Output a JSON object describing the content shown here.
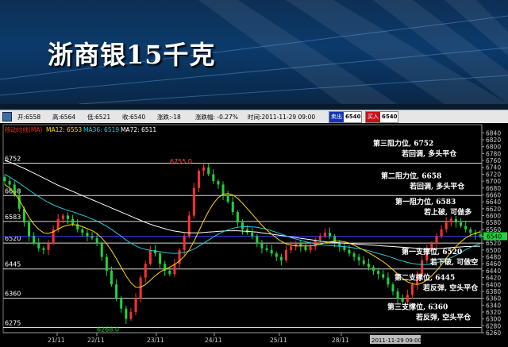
{
  "banner": {
    "title": "浙商银15千克"
  },
  "toolbar": {
    "open": "开:6558",
    "high": "高:6564",
    "low": "低:6521",
    "close": "收:6540",
    "change": "涨跌:-18",
    "change_pct": "涨跌幅: -0.27%",
    "time": "时间:2011-11-29 09:00",
    "sell_label": "卖出",
    "sell_value": "6540",
    "buy_label": "买入",
    "buy_value": "6540"
  },
  "indicator": {
    "name": "移动均线(MA)",
    "ma12": "MA12: 6553",
    "ma36": "MA36: 6519",
    "ma72": "MA72: 6511",
    "colors": {
      "ma12": "#ffd800",
      "ma36": "#29c8d8",
      "ma72": "#ffffff"
    }
  },
  "chart_data": {
    "type": "line",
    "price_range": [
      6260,
      6850
    ],
    "y_ticks": [
      "6840",
      "6820",
      "6800",
      "6780",
      "6760",
      "6740",
      "6720",
      "6700",
      "6680",
      "6660",
      "6640",
      "6620",
      "6600",
      "6580",
      "6560",
      "6540",
      "6520",
      "6500",
      "6480",
      "6460",
      "6440",
      "6420",
      "6400",
      "6380",
      "6360",
      "6340",
      "6320",
      "6300",
      "6280",
      "6260"
    ],
    "x_labels": [
      "21/11",
      "22/11",
      "23/11",
      "24/11",
      "25/11",
      "28/11"
    ],
    "x_cursor_label": "2011-11-29 09:00",
    "current_price": "6540",
    "markers": [
      {
        "label": "6755.0",
        "value": 6755
      },
      {
        "label": "6268.0",
        "value": 6268
      }
    ],
    "levels": [
      {
        "value": 6752,
        "label": "6752",
        "title": "第三阻力位, 6752",
        "advice": "若回调, 多头平仓"
      },
      {
        "value": 6658,
        "label": "6658",
        "title": "第二阻力位, 6658",
        "advice": "若回调, 多头平仓"
      },
      {
        "value": 6583,
        "label": "6583",
        "title": "第一阻力位, 6583",
        "advice": "若上破, 可做多"
      },
      {
        "value": 6520,
        "label": "6520",
        "title": "第一支撑位, 6520",
        "advice": "若下破, 可做空"
      },
      {
        "value": 6445,
        "label": "6445",
        "title": "第二支撑位, 6445",
        "advice": "若反弹, 空头平仓"
      },
      {
        "value": 6360,
        "label": "6360",
        "title": "第三支撑位, 6360",
        "advice": "若反弹, 空头平仓"
      },
      {
        "value": 6275,
        "label": "6275"
      }
    ],
    "closes": [
      6700,
      6690,
      6660,
      6620,
      6580,
      6540,
      6520,
      6505,
      6500,
      6520,
      6560,
      6590,
      6600,
      6590,
      6575,
      6560,
      6550,
      6540,
      6535,
      6520,
      6480,
      6440,
      6400,
      6360,
      6330,
      6300,
      6320,
      6360,
      6420,
      6460,
      6500,
      6490,
      6460,
      6440,
      6430,
      6460,
      6500,
      6540,
      6600,
      6680,
      6730,
      6740,
      6720,
      6700,
      6690,
      6660,
      6640,
      6610,
      6580,
      6560,
      6550,
      6540,
      6520,
      6505,
      6500,
      6490,
      6480,
      6470,
      6500,
      6510,
      6520,
      6510,
      6500,
      6510,
      6530,
      6540,
      6550,
      6540,
      6520,
      6510,
      6500,
      6490,
      6480,
      6470,
      6460,
      6450,
      6440,
      6430,
      6420,
      6400,
      6380,
      6360,
      6350,
      6370,
      6400,
      6430,
      6470,
      6500,
      6520,
      6540,
      6560,
      6580,
      6590,
      6580,
      6570,
      6560,
      6550,
      6545,
      6540
    ],
    "ma12": [
      6690,
      6680,
      6665,
      6645,
      6620,
      6595,
      6575,
      6560,
      6550,
      6548,
      6553,
      6560,
      6568,
      6572,
      6574,
      6572,
      6568,
      6562,
      6556,
      6548,
      6535,
      6518,
      6498,
      6475,
      6450,
      6425,
      6405,
      6392,
      6392,
      6400,
      6412,
      6425,
      6436,
      6444,
      6450,
      6458,
      6468,
      6482,
      6500,
      6525,
      6555,
      6585,
      6612,
      6635,
      6652,
      6662,
      6664,
      6660,
      6650,
      6636,
      6620,
      6604,
      6588,
      6572,
      6558,
      6546,
      6535,
      6525,
      6518,
      6514,
      6512,
      6512,
      6512,
      6512,
      6514,
      6517,
      6521,
      6524,
      6526,
      6526,
      6524,
      6520,
      6514,
      6507,
      6500,
      6492,
      6484,
      6475,
      6466,
      6455,
      6443,
      6430,
      6418,
      6408,
      6402,
      6400,
      6404,
      6413,
      6425,
      6440,
      6457,
      6476,
      6494,
      6510,
      6524,
      6535,
      6543,
      6549,
      6553
    ],
    "ma36": [
      6720,
      6712,
      6703,
      6694,
      6684,
      6674,
      6664,
      6655,
      6646,
      6638,
      6631,
      6625,
      6620,
      6615,
      6611,
      6606,
      6601,
      6596,
      6590,
      6584,
      6577,
      6569,
      6560,
      6550,
      6540,
      6529,
      6520,
      6512,
      6506,
      6502,
      6499,
      6497,
      6495,
      6493,
      6491,
      6490,
      6491,
      6493,
      6497,
      6503,
      6511,
      6520,
      6529,
      6538,
      6546,
      6553,
      6559,
      6563,
      6566,
      6568,
      6568,
      6567,
      6566,
      6563,
      6560,
      6556,
      6551,
      6546,
      6541,
      6536,
      6532,
      6528,
      6524,
      6521,
      6518,
      6516,
      6514,
      6513,
      6512,
      6511,
      6510,
      6508,
      6506,
      6504,
      6501,
      6498,
      6494,
      6490,
      6486,
      6482,
      6477,
      6472,
      6468,
      6464,
      6461,
      6459,
      6458,
      6458,
      6460,
      6463,
      6467,
      6472,
      6478,
      6485,
      6493,
      6501,
      6508,
      6514,
      6519
    ],
    "ma72": [
      6760,
      6755,
      6749,
      6743,
      6737,
      6730,
      6723,
      6716,
      6709,
      6702,
      6695,
      6688,
      6682,
      6676,
      6670,
      6664,
      6658,
      6652,
      6646,
      6640,
      6634,
      6628,
      6622,
      6616,
      6610,
      6604,
      6598,
      6592,
      6586,
      6580,
      6575,
      6570,
      6566,
      6562,
      6558,
      6555,
      6553,
      6551,
      6550,
      6550,
      6550,
      6551,
      6552,
      6553,
      6554,
      6555,
      6556,
      6556,
      6556,
      6555,
      6554,
      6553,
      6552,
      6550,
      6548,
      6546,
      6544,
      6542,
      6540,
      6538,
      6536,
      6534,
      6532,
      6530,
      6528,
      6526,
      6524,
      6523,
      6522,
      6521,
      6520,
      6519,
      6518,
      6517,
      6516,
      6515,
      6514,
      6513,
      6512,
      6511,
      6510,
      6509,
      6508,
      6507,
      6506,
      6505,
      6504,
      6504,
      6504,
      6504,
      6505,
      6506,
      6507,
      6508,
      6509,
      6510,
      6510,
      6511,
      6511
    ]
  }
}
